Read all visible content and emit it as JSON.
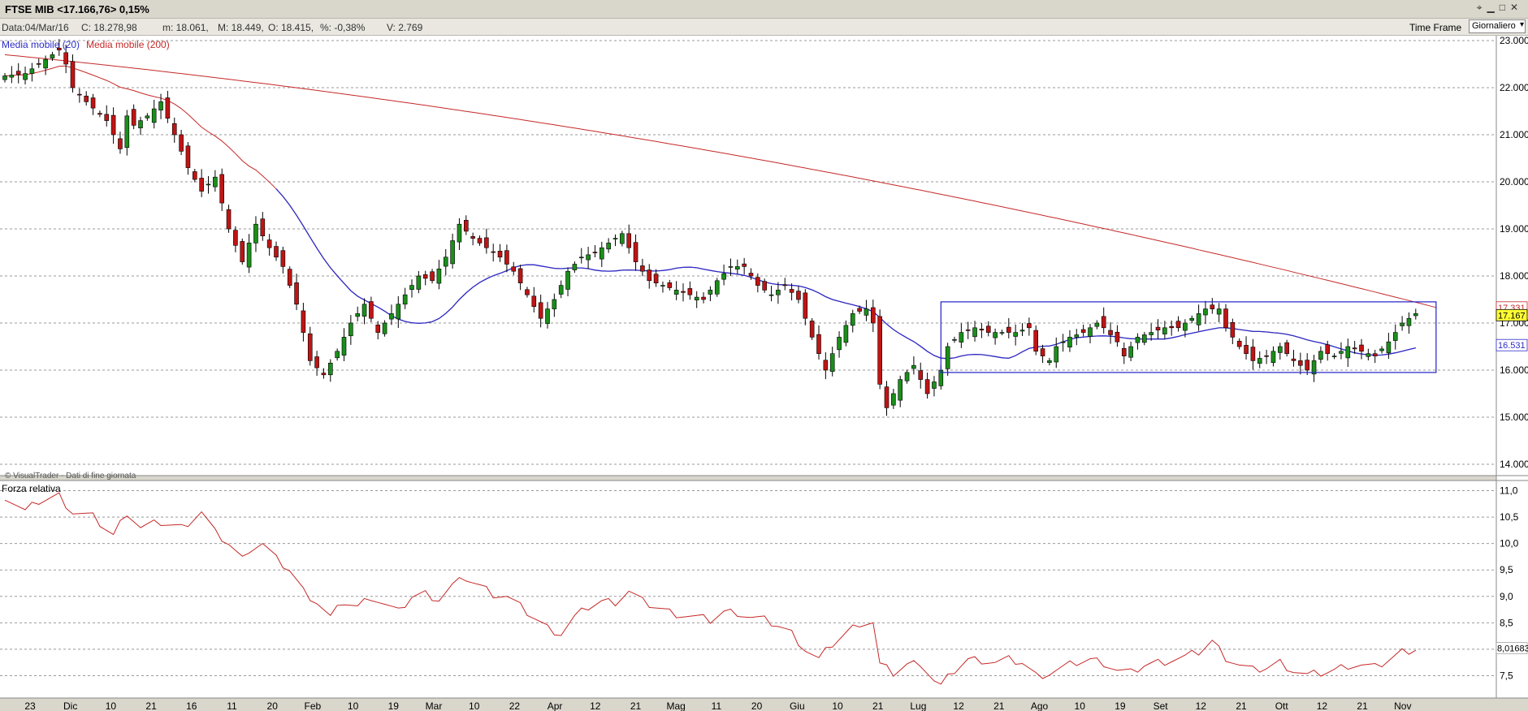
{
  "window": {
    "title": "FTSE MIB <17.166,76> 0,15%"
  },
  "info_bar": {
    "data": "Data:04/Mar/16",
    "close": "C: 18.278,98",
    "min": "m: 18.061,",
    "max": "M: 18.449,",
    "open": "O: 18.415,",
    "pct": "%: -0,38%",
    "volume": "V: 2.769",
    "timeframe_label": "Time Frame",
    "timeframe_value": "Giornaliero"
  },
  "colors": {
    "up_candle": "#1a8f1a",
    "down_candle": "#c01414",
    "ma20": "#2c2cc8",
    "ma200": "#c62828",
    "rsi": "#c62828",
    "box": "#2020c8",
    "last_price_bg": "#ffff33"
  },
  "chart_data": [
    {
      "type": "candlestick",
      "title": "FTSE MIB",
      "credit": "© VisualTrader - Dati di fine giornata",
      "ylim": [
        14000,
        23000
      ],
      "y_ticks": [
        "14.000",
        "15.000",
        "16.000",
        "17.000",
        "18.000",
        "19.000",
        "20.000",
        "21.000",
        "22.000",
        "23.000"
      ],
      "grid": true,
      "x_ticks": [
        "23",
        "Dic",
        "10",
        "21",
        "16",
        "11",
        "20",
        "Feb",
        "10",
        "19",
        "Mar",
        "10",
        "22",
        "Apr",
        "12",
        "21",
        "Mag",
        "11",
        "20",
        "Giu",
        "10",
        "21",
        "Lug",
        "12",
        "21",
        "Ago",
        "10",
        "19",
        "Set",
        "12",
        "21",
        "Ott",
        "12",
        "21",
        "Nov"
      ],
      "legend": [
        "Media mobile (20)",
        "Media mobile (200)"
      ],
      "price_labels": {
        "ma200_last": "17.331",
        "last_close": "17.167",
        "ma20_last": "16.531"
      },
      "close_anchors": [
        [
          0,
          22250
        ],
        [
          3,
          22300
        ],
        [
          6,
          22600
        ],
        [
          8,
          22800
        ],
        [
          9,
          22500
        ],
        [
          10,
          22000
        ],
        [
          12,
          21700
        ],
        [
          15,
          21300
        ],
        [
          17,
          20700
        ],
        [
          18,
          21400
        ],
        [
          19,
          21200
        ],
        [
          21,
          21400
        ],
        [
          23,
          21700
        ],
        [
          25,
          21000
        ],
        [
          27,
          20300
        ],
        [
          29,
          19800
        ],
        [
          31,
          20100
        ],
        [
          33,
          19000
        ],
        [
          35,
          18300
        ],
        [
          37,
          19100
        ],
        [
          39,
          18600
        ],
        [
          41,
          18200
        ],
        [
          43,
          17400
        ],
        [
          45,
          16200
        ],
        [
          47,
          15900
        ],
        [
          49,
          16400
        ],
        [
          51,
          17000
        ],
        [
          53,
          17400
        ],
        [
          55,
          16800
        ],
        [
          57,
          17200
        ],
        [
          59,
          17600
        ],
        [
          61,
          18000
        ],
        [
          63,
          17900
        ],
        [
          65,
          18400
        ],
        [
          67,
          19100
        ],
        [
          69,
          18800
        ],
        [
          71,
          18600
        ],
        [
          73,
          18400
        ],
        [
          75,
          18100
        ],
        [
          77,
          17600
        ],
        [
          79,
          17100
        ],
        [
          81,
          17500
        ],
        [
          83,
          18100
        ],
        [
          85,
          18400
        ],
        [
          87,
          18500
        ],
        [
          89,
          18700
        ],
        [
          91,
          18900
        ],
        [
          93,
          18300
        ],
        [
          95,
          17900
        ],
        [
          97,
          17800
        ],
        [
          99,
          17700
        ],
        [
          101,
          17600
        ],
        [
          103,
          17500
        ],
        [
          105,
          17900
        ],
        [
          107,
          18200
        ],
        [
          109,
          18200
        ],
        [
          111,
          17800
        ],
        [
          113,
          17600
        ],
        [
          115,
          17800
        ],
        [
          117,
          17500
        ],
        [
          119,
          16700
        ],
        [
          121,
          16000
        ],
        [
          123,
          16700
        ],
        [
          125,
          17200
        ],
        [
          127,
          17300
        ],
        [
          128,
          17000
        ],
        [
          129,
          15700
        ],
        [
          130,
          15200
        ],
        [
          132,
          15800
        ],
        [
          134,
          16100
        ],
        [
          136,
          15500
        ],
        [
          138,
          16000
        ],
        [
          139,
          16500
        ],
        [
          141,
          16800
        ],
        [
          143,
          16900
        ],
        [
          145,
          16800
        ],
        [
          147,
          16800
        ],
        [
          149,
          16800
        ],
        [
          151,
          16900
        ],
        [
          152,
          16400
        ],
        [
          154,
          16200
        ],
        [
          155,
          16500
        ],
        [
          157,
          16700
        ],
        [
          159,
          16800
        ],
        [
          161,
          17000
        ],
        [
          162,
          16900
        ],
        [
          164,
          16600
        ],
        [
          165,
          16300
        ],
        [
          167,
          16700
        ],
        [
          169,
          16800
        ],
        [
          171,
          16900
        ],
        [
          173,
          16900
        ],
        [
          175,
          17100
        ],
        [
          177,
          17300
        ],
        [
          179,
          17300
        ],
        [
          180,
          16900
        ],
        [
          182,
          16500
        ],
        [
          184,
          16200
        ],
        [
          186,
          16300
        ],
        [
          188,
          16500
        ],
        [
          190,
          16200
        ],
        [
          192,
          16000
        ],
        [
          194,
          16400
        ],
        [
          196,
          16300
        ],
        [
          198,
          16500
        ],
        [
          200,
          16400
        ],
        [
          202,
          16300
        ],
        [
          204,
          16600
        ],
        [
          206,
          17000
        ],
        [
          208,
          17200
        ]
      ],
      "candle_count": 209,
      "ma20_start_index": 40,
      "ma200_start": 22700,
      "ma200_end": 17331,
      "highlight_box": {
        "x_from_index": 138,
        "x_to_index": 211,
        "y_from": 15950,
        "y_to": 17450
      }
    },
    {
      "type": "line",
      "title": "Forza relativa",
      "ylim": [
        7.2,
        11.1
      ],
      "y_ticks": [
        "7,5",
        "8,0",
        "8,5",
        "9,0",
        "9,5",
        "10,0",
        "10,5",
        "11,0"
      ],
      "last_value_label": "8,01683",
      "anchors": [
        [
          0,
          10.9
        ],
        [
          3,
          10.6
        ],
        [
          5,
          10.8
        ],
        [
          8,
          10.9
        ],
        [
          10,
          10.6
        ],
        [
          13,
          10.5
        ],
        [
          16,
          10.15
        ],
        [
          18,
          10.6
        ],
        [
          20,
          10.3
        ],
        [
          23,
          10.4
        ],
        [
          26,
          10.3
        ],
        [
          29,
          10.6
        ],
        [
          31,
          10.2
        ],
        [
          33,
          10.0
        ],
        [
          35,
          9.7
        ],
        [
          36,
          9.9
        ],
        [
          38,
          10.0
        ],
        [
          40,
          9.7
        ],
        [
          42,
          9.5
        ],
        [
          44,
          9.1
        ],
        [
          46,
          8.9
        ],
        [
          48,
          8.6
        ],
        [
          50,
          8.9
        ],
        [
          52,
          8.8
        ],
        [
          54,
          9.0
        ],
        [
          56,
          8.85
        ],
        [
          58,
          8.7
        ],
        [
          60,
          9.0
        ],
        [
          62,
          9.05
        ],
        [
          64,
          8.95
        ],
        [
          66,
          9.2
        ],
        [
          68,
          9.35
        ],
        [
          70,
          9.2
        ],
        [
          72,
          9.05
        ],
        [
          74,
          9.0
        ],
        [
          76,
          8.8
        ],
        [
          78,
          8.6
        ],
        [
          80,
          8.4
        ],
        [
          82,
          8.3
        ],
        [
          84,
          8.6
        ],
        [
          86,
          8.8
        ],
        [
          88,
          8.9
        ],
        [
          90,
          8.9
        ],
        [
          92,
          9.1
        ],
        [
          94,
          8.9
        ],
        [
          96,
          8.8
        ],
        [
          98,
          8.7
        ],
        [
          100,
          8.65
        ],
        [
          102,
          8.6
        ],
        [
          104,
          8.55
        ],
        [
          106,
          8.7
        ],
        [
          108,
          8.7
        ],
        [
          110,
          8.6
        ],
        [
          112,
          8.55
        ],
        [
          114,
          8.45
        ],
        [
          116,
          8.3
        ],
        [
          118,
          8.0
        ],
        [
          120,
          7.8
        ],
        [
          122,
          8.1
        ],
        [
          124,
          8.3
        ],
        [
          126,
          8.5
        ],
        [
          128,
          8.5
        ],
        [
          129,
          7.7
        ],
        [
          131,
          7.55
        ],
        [
          133,
          7.7
        ],
        [
          135,
          7.75
        ],
        [
          137,
          7.4
        ],
        [
          138,
          7.3
        ],
        [
          140,
          7.6
        ],
        [
          142,
          7.8
        ],
        [
          144,
          7.8
        ],
        [
          146,
          7.75
        ],
        [
          148,
          7.8
        ],
        [
          150,
          7.75
        ],
        [
          152,
          7.5
        ],
        [
          154,
          7.55
        ],
        [
          156,
          7.65
        ],
        [
          158,
          7.75
        ],
        [
          160,
          7.8
        ],
        [
          162,
          7.75
        ],
        [
          164,
          7.6
        ],
        [
          166,
          7.55
        ],
        [
          168,
          7.7
        ],
        [
          170,
          7.75
        ],
        [
          172,
          7.8
        ],
        [
          174,
          7.85
        ],
        [
          176,
          7.95
        ],
        [
          178,
          8.15
        ],
        [
          180,
          7.85
        ],
        [
          182,
          7.7
        ],
        [
          184,
          7.6
        ],
        [
          186,
          7.65
        ],
        [
          188,
          7.75
        ],
        [
          190,
          7.6
        ],
        [
          192,
          7.5
        ],
        [
          194,
          7.55
        ],
        [
          196,
          7.6
        ],
        [
          198,
          7.7
        ],
        [
          200,
          7.7
        ],
        [
          202,
          7.65
        ],
        [
          204,
          7.8
        ],
        [
          206,
          7.95
        ],
        [
          208,
          8.02
        ]
      ]
    }
  ]
}
